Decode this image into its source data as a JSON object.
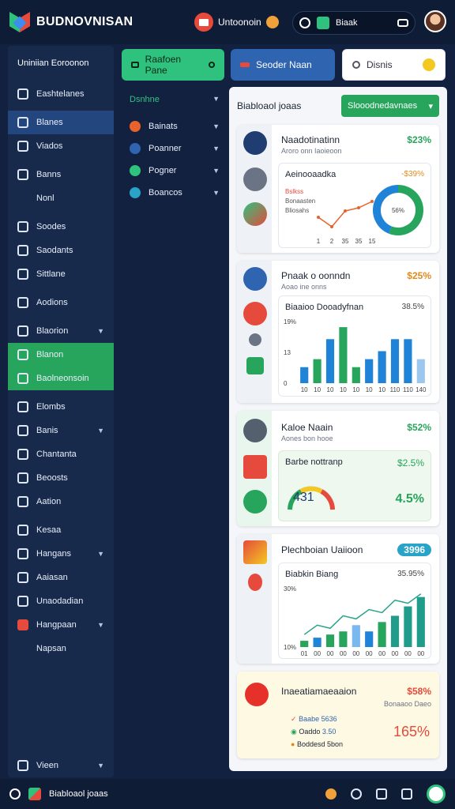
{
  "topbar": {
    "app_title": "BUDNOVNISAN",
    "center_label": "Untoonoin",
    "pill_label": "Biaak"
  },
  "sidebar": {
    "header": "Uniniian Eoroonon",
    "items": [
      {
        "label": "Eashtelanes",
        "icon": "home-icon"
      },
      {
        "label": "Blanes",
        "icon": "document-icon",
        "active": true
      },
      {
        "label": "Viados",
        "icon": "send-icon"
      },
      {
        "label": "Banns",
        "icon": "gear-icon"
      },
      {
        "label": "Nonl",
        "icon": ""
      },
      {
        "label": "Soodes",
        "icon": "grid-icon"
      },
      {
        "label": "Saodants",
        "icon": "check-icon"
      },
      {
        "label": "Sittlane",
        "icon": "file-icon"
      },
      {
        "label": "Aodions",
        "icon": "pen-icon"
      },
      {
        "label": "Blaorion",
        "icon": "folder-icon",
        "chevron": true
      },
      {
        "label": "Blanon",
        "icon": "image-icon",
        "green": true
      },
      {
        "label": "Baolneonsoin",
        "icon": "image-icon",
        "green": true
      },
      {
        "label": "Elombs",
        "icon": "gear-icon"
      },
      {
        "label": "Banis",
        "icon": "mail-icon",
        "chevron": true
      },
      {
        "label": "Chantanta",
        "icon": "chart-icon"
      },
      {
        "label": "Beoosts",
        "icon": "list-icon"
      },
      {
        "label": "Aation",
        "icon": "gear-icon"
      },
      {
        "label": "Kesaa",
        "icon": "list-icon"
      },
      {
        "label": "Hangans",
        "icon": "tag-icon",
        "chevron": true
      },
      {
        "label": "Aaiasan",
        "icon": "image-icon"
      },
      {
        "label": "Unaodadian",
        "icon": "grid-icon"
      },
      {
        "label": "Hangpaan",
        "icon": "flag-icon",
        "chevron": true
      },
      {
        "label": "Napsan",
        "icon": ""
      }
    ],
    "bottom_label": "Vieen"
  },
  "toolbar": {
    "green_label": "Raafoen Pane",
    "blue_label": "Seoder Naan",
    "search_placeholder": "Disnis"
  },
  "subnav": {
    "header": "Dsnhne",
    "items": [
      {
        "label": "Bainats",
        "color": "#e8622a"
      },
      {
        "label": "Poanner",
        "color": "#2f64b0"
      },
      {
        "label": "Pogner",
        "color": "#2ec27e"
      },
      {
        "label": "Boancos",
        "color": "#2aa3c8"
      }
    ]
  },
  "panel": {
    "title": "Biabloaol joaas",
    "button_label": "Slooodnedavnaes",
    "cards": [
      {
        "name": "Naadotinatinn",
        "value": "$23%",
        "value_color": "#27a55c",
        "sub": "Aroro onn Iaoieoon",
        "inner_title": "Aeinooaadka",
        "inner_value": "-$39%",
        "legend": [
          "Bslkss",
          "Bonaasten",
          "Bliosahs"
        ],
        "ring_label": "56%"
      },
      {
        "name": "Pnaak o oonndn",
        "value": "$25%",
        "value_color": "#e08a1e",
        "sub": "Aoao ine onns",
        "inner_title": "Biaaioo Dooadyfnan",
        "inner_value": "38.5%"
      },
      {
        "name": "Kaloe Naain",
        "value": "$52%",
        "value_color": "#27a55c",
        "sub": "Aones bon hooe",
        "inner_title": "Barbe nottranp",
        "inner_value": "$2.5%",
        "gauge_value": "431",
        "side_value": "4.5%"
      },
      {
        "name": "Plechboian Uaiioon",
        "value": "3996",
        "value_color": "#2aa3c8",
        "inner_title": "Biabkin Biang",
        "inner_value": "35.95%"
      },
      {
        "name": "Inaeatiamaeaaion",
        "value": "$58%",
        "value_color": "#e64a3c",
        "sub": "Bonaaoo Daeo",
        "rows": [
          {
            "label": "Baabe",
            "value": "5636"
          },
          {
            "label": "Oaddo",
            "value": "3.50"
          },
          {
            "label": "Boddesd",
            "value": "5bon"
          }
        ],
        "big_value": "165%"
      }
    ]
  },
  "chart_data": [
    {
      "type": "line",
      "x": [
        "1",
        "2",
        "35",
        "35",
        "15"
      ],
      "y": [
        10,
        4,
        14,
        16,
        20
      ],
      "title": "Aeinooaadka",
      "legend": [
        "Bslkss",
        "Bonaasten",
        "Bliosahs"
      ]
    },
    {
      "type": "pie",
      "values": [
        56,
        44
      ],
      "colors": [
        "#27a55c",
        "#1f84d8"
      ],
      "center_label": "56%"
    },
    {
      "type": "bar",
      "title": "Biaaioo Dooadyfnan",
      "categories": [
        "10",
        "10",
        "10",
        "10",
        "10",
        "10",
        "10",
        "110",
        "110",
        "140"
      ],
      "values": [
        8,
        12,
        22,
        28,
        8,
        12,
        16,
        22,
        22,
        12
      ],
      "ytick_labels": [
        "19%",
        "13",
        "0"
      ]
    },
    {
      "type": "bar",
      "title": "Biabkin Biang",
      "categories": [
        "01",
        "00",
        "00",
        "00",
        "00",
        "00",
        "00",
        "00",
        "00",
        "00"
      ],
      "values": [
        4,
        6,
        8,
        10,
        14,
        10,
        16,
        20,
        26,
        32
      ],
      "trend": [
        8,
        14,
        12,
        20,
        18,
        24,
        22,
        30,
        28,
        34
      ],
      "ytick_labels": [
        "30%",
        "10%"
      ]
    }
  ]
}
